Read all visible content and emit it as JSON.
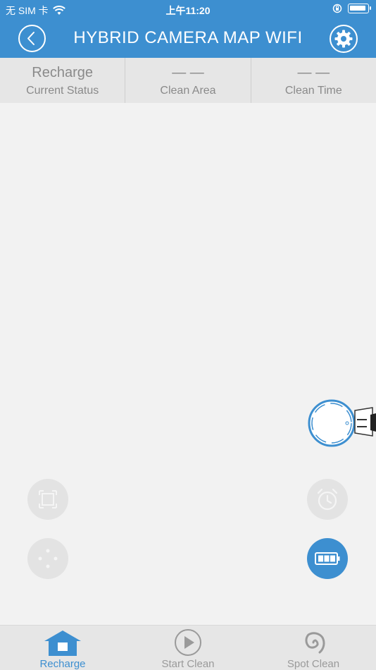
{
  "status_bar": {
    "carrier": "无 SIM 卡",
    "time": "上午11:20"
  },
  "header": {
    "title": "HYBRID CAMERA MAP WIFI"
  },
  "stats": [
    {
      "value": "Recharge",
      "label": "Current Status"
    },
    {
      "value": "— —",
      "label": "Clean Area"
    },
    {
      "value": "— —",
      "label": "Clean Time"
    }
  ],
  "tabs": [
    {
      "label": "Recharge",
      "active": true
    },
    {
      "label": "Start Clean",
      "active": false
    },
    {
      "label": "Spot Clean",
      "active": false
    }
  ],
  "colors": {
    "accent": "#3d8fd0",
    "inactive": "#9a9a9a",
    "background": "#f2f2f2"
  }
}
